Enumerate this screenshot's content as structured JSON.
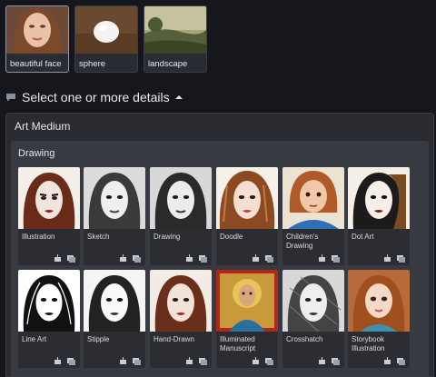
{
  "subjects": [
    {
      "label": "beautiful face",
      "icon": "face-thumbnail",
      "selected": true
    },
    {
      "label": "sphere",
      "icon": "sphere-thumbnail",
      "selected": false
    },
    {
      "label": "landscape",
      "icon": "landscape-thumbnail",
      "selected": false
    }
  ],
  "details": {
    "title": "Select one or more details"
  },
  "art_medium": {
    "title": "Art Medium",
    "group_title": "Drawing",
    "items": [
      {
        "label": "Illustration",
        "icon": "illustration-thumbnail"
      },
      {
        "label": "Sketch",
        "icon": "sketch-thumbnail"
      },
      {
        "label": "Drawing",
        "icon": "drawing-thumbnail"
      },
      {
        "label": "Doodle",
        "icon": "doodle-thumbnail"
      },
      {
        "label": "Children's Drawing",
        "icon": "childrens-drawing-thumbnail"
      },
      {
        "label": "Dot Art",
        "icon": "dot-art-thumbnail"
      },
      {
        "label": "Line Art",
        "icon": "line-art-thumbnail"
      },
      {
        "label": "Stipple",
        "icon": "stipple-thumbnail"
      },
      {
        "label": "Hand-Drawn",
        "icon": "hand-drawn-thumbnail"
      },
      {
        "label": "Illuminated Manuscript",
        "icon": "illuminated-manuscript-thumbnail"
      },
      {
        "label": "Crosshatch",
        "icon": "crosshatch-thumbnail"
      },
      {
        "label": "Storybook Illustration",
        "icon": "storybook-illustration-thumbnail"
      }
    ]
  }
}
